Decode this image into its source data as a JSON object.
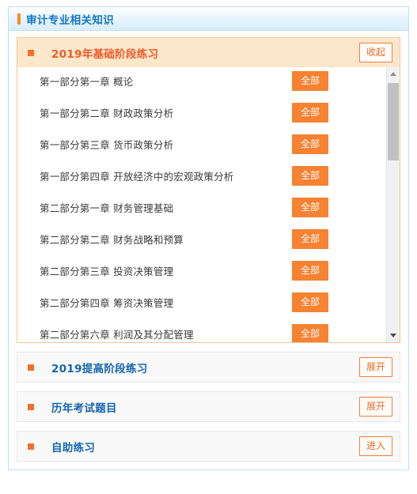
{
  "header": {
    "title": "审计专业相关知识",
    "tick_icon": "vertical-bar-icon",
    "accent_blue": "#1277c4",
    "accent_orange": "#f68b2c"
  },
  "colors": {
    "solid_button_bg": "#f68232",
    "ghost_button_border": "#f0803e",
    "ghost_button_text": "#ef6a28",
    "open_panel_header_bg": "#fce7ca",
    "open_panel_title": "#f2592a",
    "closed_panel_bg": "#f9f9f9",
    "closed_panel_title": "#1565b0",
    "bullet": "#f2702a",
    "row_text": "#3a3a3a"
  },
  "open_panel": {
    "bullet_icon": "square-bullet-icon",
    "title": "2019年基础阶段练习",
    "toggle_label": "收起",
    "rows": [
      {
        "label": "第一部分第一章  概论",
        "action_label": "全部"
      },
      {
        "label": "第一部分第二章  财政政策分析",
        "action_label": "全部"
      },
      {
        "label": "第一部分第三章  货币政策分析",
        "action_label": "全部"
      },
      {
        "label": "第一部分第四章  开放经济中的宏观政策分析",
        "action_label": "全部"
      },
      {
        "label": "第二部分第一章  财务管理基础",
        "action_label": "全部"
      },
      {
        "label": "第二部分第二章  财务战略和预算",
        "action_label": "全部"
      },
      {
        "label": "第二部分第三章  投资决策管理",
        "action_label": "全部"
      },
      {
        "label": "第二部分第四章  筹资决策管理",
        "action_label": "全部"
      },
      {
        "label": "第二部分第六章  利润及其分配管理",
        "action_label": "全部"
      }
    ],
    "scrollbar": {
      "up_arrow_icon": "triangle-up-icon",
      "down_arrow_icon": "triangle-down-icon",
      "thumb_icon": "scrollbar-thumb"
    }
  },
  "closed_panels": [
    {
      "bullet_icon": "square-bullet-icon",
      "title": "2019提高阶段练习",
      "toggle_label": "展开"
    },
    {
      "bullet_icon": "square-bullet-icon",
      "title": "历年考试题目",
      "toggle_label": "展开"
    },
    {
      "bullet_icon": "square-bullet-icon",
      "title": "自助练习",
      "toggle_label": "进入"
    }
  ]
}
